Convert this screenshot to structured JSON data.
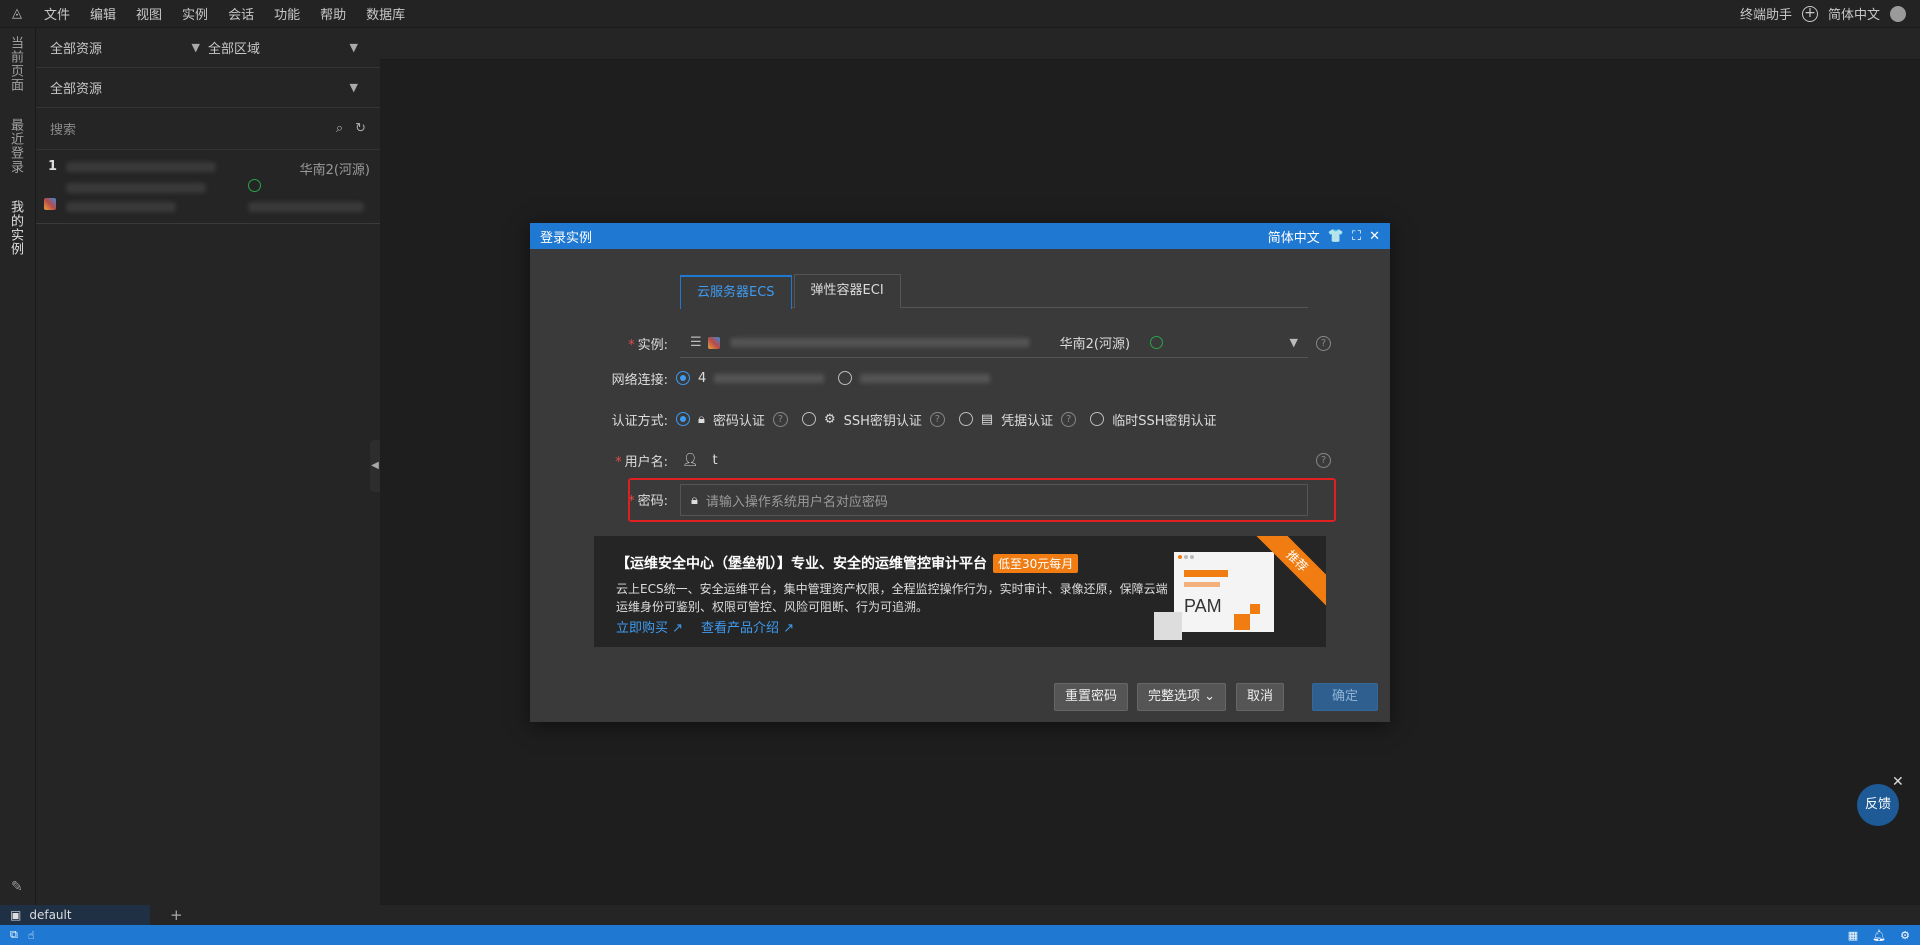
{
  "menubar": {
    "items": [
      "文件",
      "编辑",
      "视图",
      "实例",
      "会话",
      "功能",
      "帮助",
      "数据库"
    ],
    "assistant": "终端助手",
    "language": "简体中文"
  },
  "rail": {
    "tabs": [
      "当前页面",
      "最近登录",
      "我的实例"
    ]
  },
  "side": {
    "filter1": "全部资源",
    "filter2": "全部区域",
    "filter3": "全部资源",
    "search_placeholder": "搜索",
    "instance": {
      "index": "1",
      "region": "华南2(河源)"
    }
  },
  "dialog": {
    "title": "登录实例",
    "lang": "简体中文",
    "tabs": [
      "云服务器ECS",
      "弹性容器ECI"
    ],
    "instance_label": "实例:",
    "instance_region": "华南2(河源)",
    "network_label": "网络连接:",
    "network_opt1": "4",
    "auth_label": "认证方式:",
    "auth_options": [
      "密码认证",
      "SSH密钥认证",
      "凭据认证",
      "临时SSH密钥认证"
    ],
    "username_label": "用户名:",
    "username_value": "t",
    "password_label": "密码:",
    "password_placeholder": "请输入操作系统用户名对应密码",
    "banner": {
      "title": "【运维安全中心（堡垒机）】专业、安全的运维管控审计平台",
      "badge": "低至30元每月",
      "desc": "云上ECS统一、安全运维平台，集中管理资产权限，全程监控操作行为，实时审计、录像还原，保障云端运维身份可鉴别、权限可管控、风险可阻断、行为可追溯。",
      "link_buy": "立即购买",
      "link_intro": "查看产品介绍",
      "ribbon": "推荐",
      "illus_text": "PAM"
    },
    "buttons": {
      "reset": "重置密码",
      "options": "完整选项",
      "cancel": "取消",
      "ok": "确定"
    }
  },
  "terminal": {
    "tab": "default"
  },
  "feedback": "反馈",
  "colors": {
    "accent": "#1f78d1",
    "highlight": "#e02020",
    "orange": "#f07c12"
  }
}
